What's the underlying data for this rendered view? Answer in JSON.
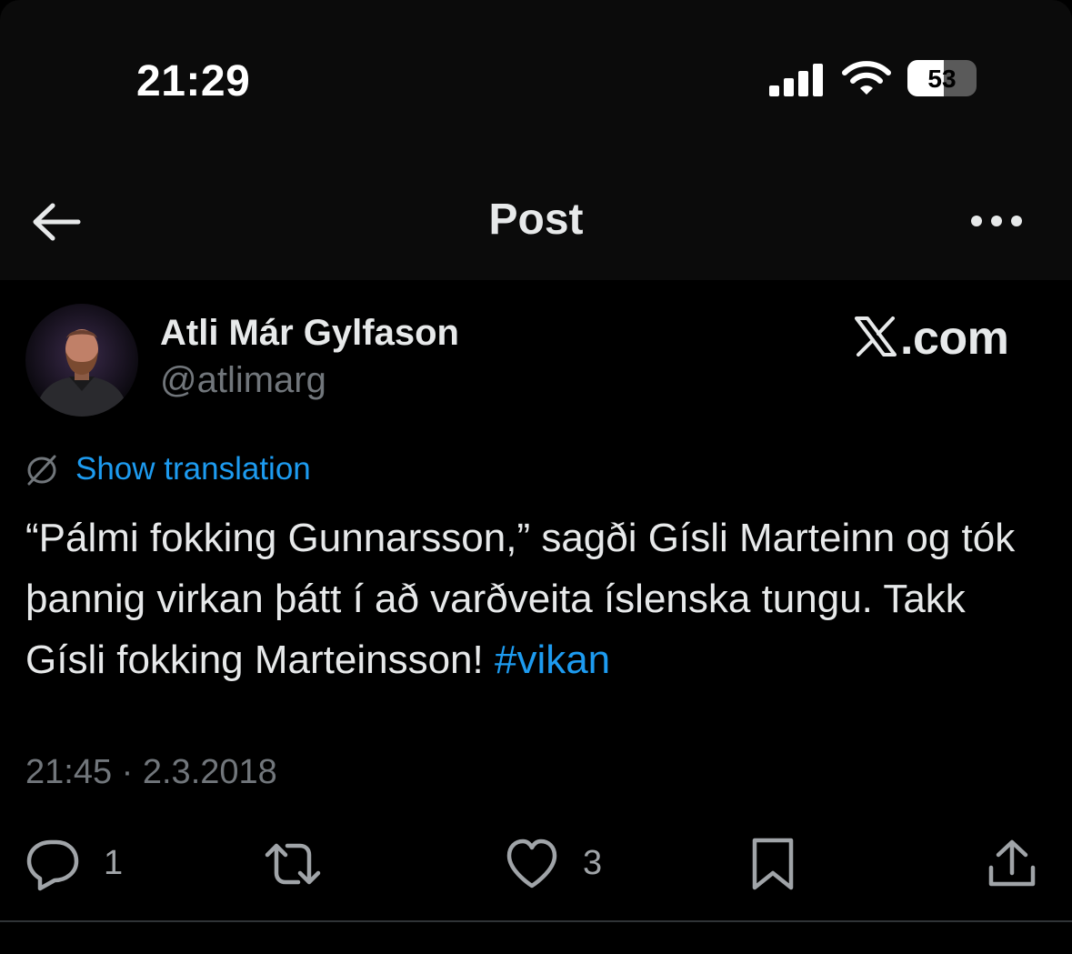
{
  "status_bar": {
    "time": "21:29",
    "battery_percent": "53",
    "battery_level": 0.53
  },
  "header": {
    "title": "Post"
  },
  "post": {
    "author_name": "Atli Már Gylfason",
    "author_handle": "@atlimarg",
    "brand_label": ".com",
    "translate_label": "Show translation",
    "text_main": "“Pálmi fokking Gunnarsson,” sagði Gísli Marteinn og tók þannig virkan þátt í að varðveita íslenska tungu. Takk Gísli fokking Marteinsson! ",
    "hashtag": "#vikan",
    "timestamp": "21:45 · 2.3.2018"
  },
  "actions": {
    "replies": "1",
    "reposts": "",
    "likes": "3"
  },
  "colors": {
    "background": "#000000",
    "accent": "#1d9bf0",
    "muted": "#71767b",
    "text": "#e7e9ea"
  },
  "icons": [
    "back-arrow-icon",
    "more-icon",
    "x-logo-icon",
    "translate-icon",
    "reply-icon",
    "repost-icon",
    "like-icon",
    "bookmark-icon",
    "share-icon"
  ]
}
